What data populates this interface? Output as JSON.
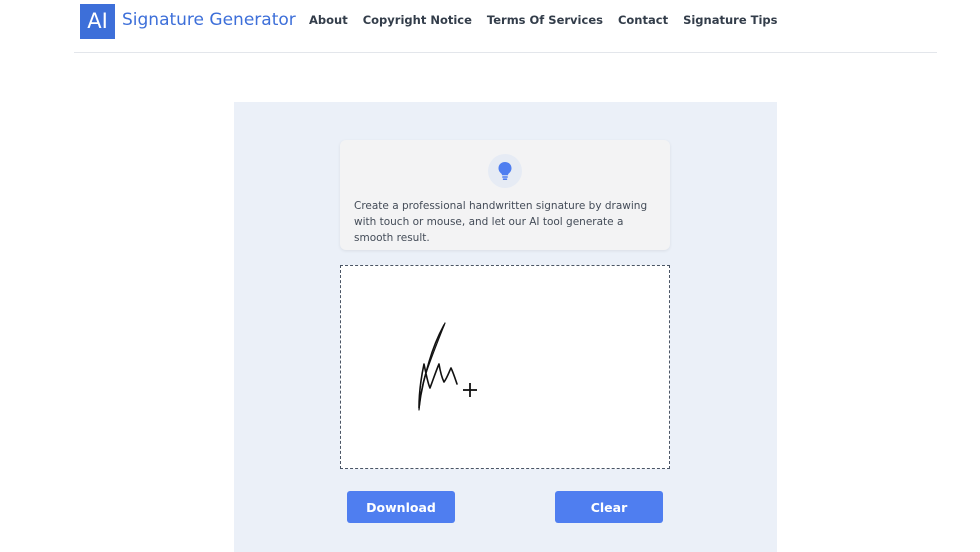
{
  "header": {
    "logo_badge": "AI",
    "logo_text": "Signature Generator",
    "nav": [
      "About",
      "Copyright Notice",
      "Terms Of Services",
      "Contact",
      "Signature Tips"
    ]
  },
  "info": {
    "icon": "lightbulb-icon",
    "text": "Create a professional handwritten signature by drawing with touch or mouse, and let our AI tool generate a smooth result."
  },
  "actions": {
    "download_label": "Download",
    "clear_label": "Clear"
  },
  "colors": {
    "brand": "#3d6fd9",
    "button": "#4f7ef0",
    "panel_bg": "#ebf0f8"
  }
}
